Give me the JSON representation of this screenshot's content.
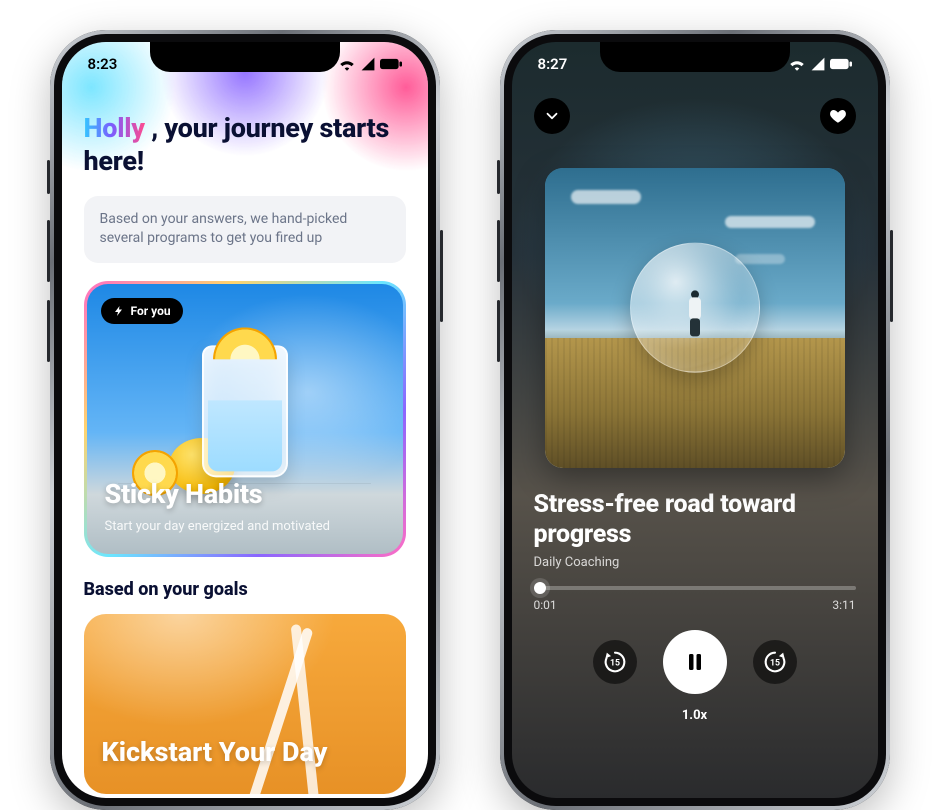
{
  "status": {
    "time": "8:23"
  },
  "status_b": {
    "time": "8:27"
  },
  "home": {
    "greeting_name": "Holly",
    "greeting_rest": " , your journey starts here!",
    "info": "Based on your answers, we hand-picked several programs to get you fired up",
    "badge": "For you",
    "hero_title": "Sticky Habits",
    "hero_sub": "Start your day energized and motivated",
    "section": "Based on your goals",
    "card2_title": "Kickstart Your Day"
  },
  "player": {
    "title": "Stress-free road toward progress",
    "subtitle": "Daily Coaching",
    "elapsed": "0:01",
    "total": "3:11",
    "skip_seconds": "15",
    "speed": "1.0x"
  }
}
